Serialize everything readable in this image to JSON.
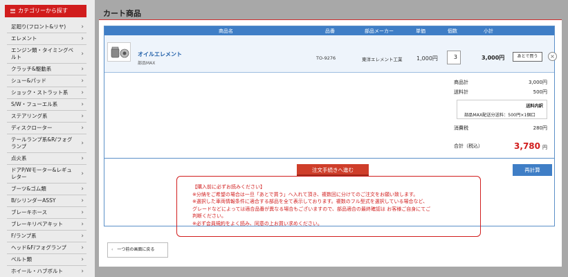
{
  "sidebar": {
    "header": "カテゴリーから探す",
    "items": [
      "足廻り(フロント&リヤ)",
      "エレメント",
      "エンジン類・タイミングベルト",
      "クラッチ&駆動系",
      "シュー&パッド",
      "ショック・ストラット系",
      "S/W・フューエル系",
      "ステアリング系",
      "ディスクローター",
      "テールランプ系&R/フォグランプ",
      "点火系",
      "ドアP/Wモーター&レギュレター",
      "ブーツ&ゴム類",
      "B/シリンダーASSY",
      "ブレーキホース",
      "ブレーキリペアキット",
      "F/ランプ系",
      "ヘッド&F/フォグランプ",
      "ベルト類",
      "ホイール・ハブボルト"
    ]
  },
  "page": {
    "title": "カート商品"
  },
  "table": {
    "headers": {
      "name": "商品名",
      "part_no": "品番",
      "maker": "部品メーカー",
      "price": "単価",
      "qty": "個数",
      "subtotal": "小計"
    },
    "items": [
      {
        "name": "オイルエレメント",
        "shop": "部品MAX",
        "part_no": "TO-9276",
        "maker": "東洋エレメント工業",
        "price": "1,000円",
        "qty": "3",
        "subtotal": "3,000円"
      }
    ],
    "later_label": "あとで買う",
    "remove_label": "×"
  },
  "summary": {
    "goods_label": "商品計",
    "goods_value": "3,000円",
    "shipping_label": "送料計",
    "shipping_value": "500円",
    "shipping_detail_title": "送料内訳",
    "shipping_detail": "部品MAX配送分送料：500円×1個口",
    "tax_label": "消費税",
    "tax_value": "280円",
    "total_label": "合計（税込）",
    "total_value": "3,780",
    "total_unit": "円"
  },
  "actions": {
    "order": "注文手続きへ進む",
    "recalc": "再計算",
    "back": "一つ前の画面に戻る"
  },
  "notice": [
    "【購入前に必ずお読みください】",
    "※分納をご希望の場合は一旦「あとで買う」へ入れて頂き、複数回に分けてのご注文をお願い致します。",
    "※選択した車両情報条件に適合する部品を全て表示しております。複数のフル型式を選択している場合など、",
    "グレードなどによっては適合品番が異なる場合もございますので、部品適合の最終確認は お客様ご自身にてご",
    "判断ください。",
    "※必ず会員規約をよく読み、同意の上お買い求めください。"
  ],
  "colors": {
    "accent_red": "#d11d1d",
    "accent_blue": "#3f7ec6",
    "order_button": "#cf3e2a"
  }
}
